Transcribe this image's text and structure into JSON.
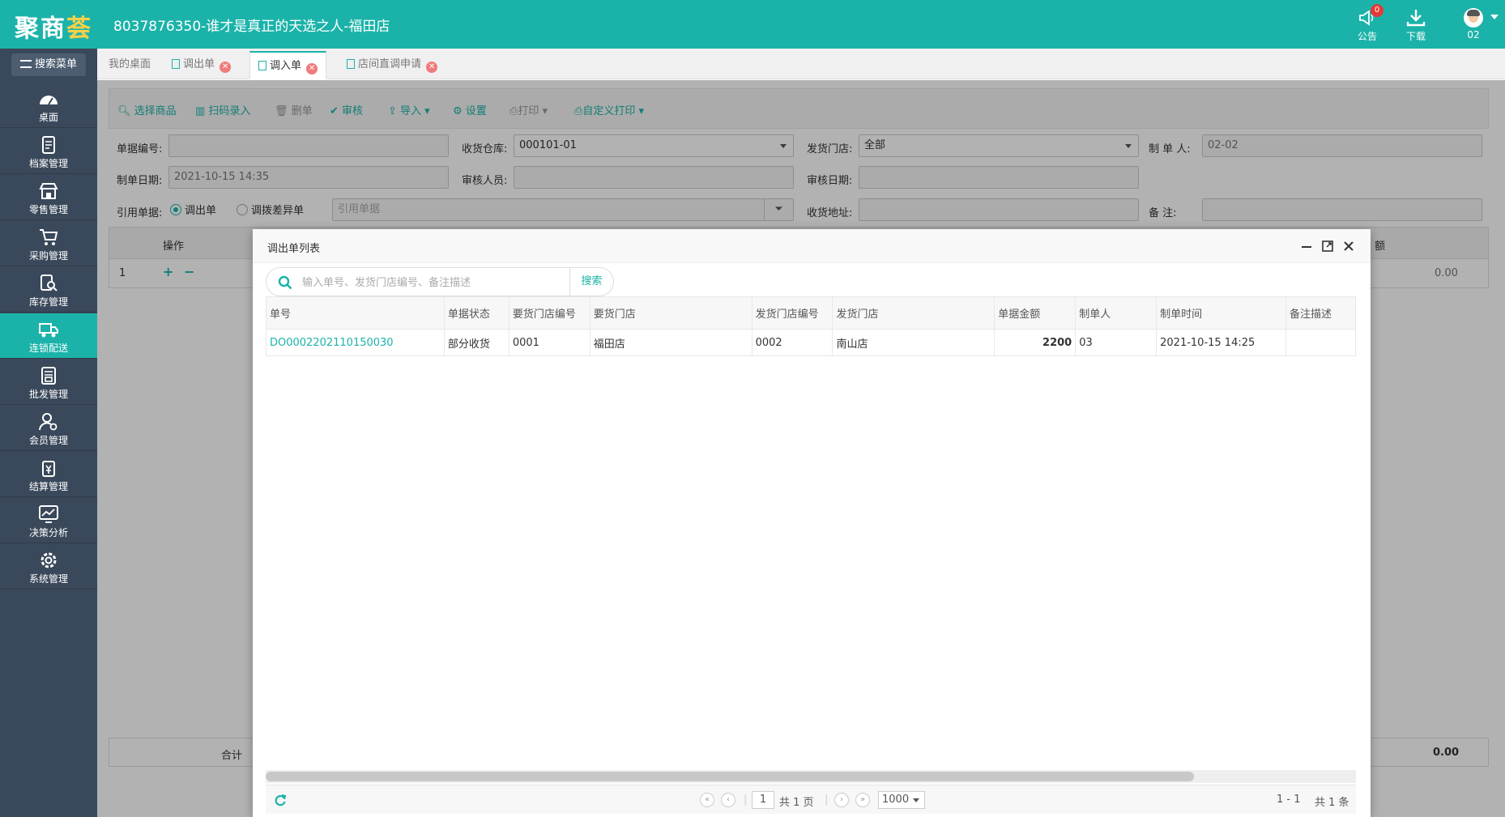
{
  "header": {
    "logo_main": "聚商",
    "logo_accent": "荟",
    "title": "8037876350-谁才是真正的天选之人-福田店",
    "notice_label": "公告",
    "notice_count": "0",
    "download_label": "下载",
    "user_label": "02"
  },
  "sidebar": {
    "search_menu": "搜索菜单",
    "items": [
      {
        "label": "桌面"
      },
      {
        "label": "档案管理"
      },
      {
        "label": "零售管理"
      },
      {
        "label": "采购管理"
      },
      {
        "label": "库存管理"
      },
      {
        "label": "连锁配送"
      },
      {
        "label": "批发管理"
      },
      {
        "label": "会员管理"
      },
      {
        "label": "结算管理"
      },
      {
        "label": "决策分析"
      },
      {
        "label": "系统管理"
      }
    ]
  },
  "tabs": [
    {
      "label": "我的桌面"
    },
    {
      "label": "调出单"
    },
    {
      "label": "调入单"
    },
    {
      "label": "店间直调申请"
    }
  ],
  "toolbar": {
    "select_goods": "选择商品",
    "scan_entry": "扫码录入",
    "delete_row": "删单",
    "audit": "审核",
    "import": "导入",
    "settings": "设置",
    "print": "打印",
    "custom_print": "自定义打印"
  },
  "form": {
    "doc_no_label": "单据编号:",
    "doc_no_value": "",
    "warehouse_label": "收货仓库:",
    "warehouse_value": "000101-01",
    "send_store_label": "发货门店:",
    "send_store_value": "全部",
    "maker_label": "制 单 人:",
    "maker_value": "02-02",
    "date_label": "制单日期:",
    "date_value": "2021-10-15 14:35",
    "auditor_label": "审核人员:",
    "audit_date_label": "审核日期:",
    "ref_label": "引用单据:",
    "ref_opt1": "调出单",
    "ref_opt2": "调拨差异单",
    "ref_placeholder": "引用单据",
    "address_label": "收货地址:",
    "remark_label": "备    注:"
  },
  "grid": {
    "col_op": "操作",
    "col_amount": "额",
    "row_index": "1",
    "row_add": "+",
    "row_remove": "−",
    "row_amount": "0.00",
    "foot_label": "合计",
    "foot_amount": "0.00"
  },
  "modal": {
    "title": "调出单列表",
    "search_placeholder": "输入单号、发货门店编号、备注描述",
    "search_button": "搜索",
    "columns": [
      "单号",
      "单据状态",
      "要货门店编号",
      "要货门店",
      "发货门店编号",
      "发货门店",
      "单据金额",
      "制单人",
      "制单时间",
      "备注描述"
    ],
    "rows": [
      {
        "doc_no": "DO0002202110150030",
        "status": "部分收货",
        "req_store_no": "0001",
        "req_store": "福田店",
        "send_store_no": "0002",
        "send_store": "南山店",
        "amount": "2200",
        "maker": "03",
        "time": "2021-10-15 14:25",
        "remark": ""
      }
    ],
    "pager": {
      "page": "1",
      "total_pages": "共 1 页",
      "page_size": "1000",
      "range": "1 - 1",
      "total": "共 1 条"
    }
  }
}
